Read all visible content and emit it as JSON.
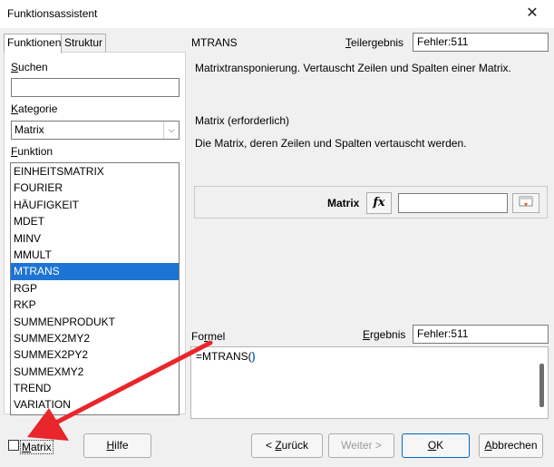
{
  "window": {
    "title": "Funktionsassistent",
    "close_glyph": "✕"
  },
  "tabs": [
    {
      "label": "Funktionen",
      "active": true
    },
    {
      "label": "Struktur",
      "active": false
    }
  ],
  "left_panel": {
    "search_label": "Suchen",
    "search_value": "",
    "category_label": "Kategorie",
    "category_value": "Matrix",
    "function_label": "Funktion",
    "functions": [
      "EINHEITSMATRIX",
      "FOURIER",
      "HÄUFIGKEIT",
      "MDET",
      "MINV",
      "MMULT",
      "MTRANS",
      "RGP",
      "RKP",
      "SUMMENPRODUKT",
      "SUMMEX2MY2",
      "SUMMEX2PY2",
      "SUMMEXMY2",
      "TREND",
      "VARIATION"
    ],
    "selected_function": "MTRANS"
  },
  "right_panel": {
    "function_name": "MTRANS",
    "partial_result_label": "Teilergebnis",
    "partial_result_value": "Fehler:511",
    "description": "Matrixtransponierung. Vertauscht Zeilen und Spalten einer Matrix.",
    "argument_title": "Matrix (erforderlich)",
    "argument_description": "Die Matrix, deren Zeilen und Spalten vertauscht werden.",
    "argument_label": "Matrix",
    "argument_value": "",
    "fx_icon_text": "fx",
    "formula_label": "Formel",
    "result_label": "Ergebnis",
    "result_value": "Fehler:511",
    "formula_text_before": "=MTRANS(",
    "formula_text_cursor": ")",
    "formula_text_after": ""
  },
  "footer": {
    "matrix_checkbox_label": "Matrix",
    "matrix_checked": false,
    "help_button": "Hilfe",
    "back_button": "< Zurück",
    "next_button": "Weiter >",
    "ok_button": "OK",
    "cancel_button": "Abbrechen"
  },
  "colors": {
    "selection": "#1c74d4",
    "annotation_arrow": "#e8262b",
    "default_button_border": "#0067c0"
  }
}
